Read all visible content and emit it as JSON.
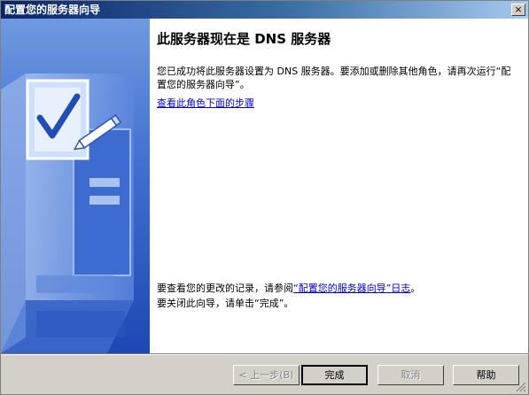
{
  "window": {
    "title": "配置您的服务器向导",
    "close_glyph": "×"
  },
  "content": {
    "heading": "此服务器现在是 DNS 服务器",
    "description": "您已成功将此服务器设置为 DNS 服务器。要添加或删除其他角色，请再次运行“配置您的服务器向导”。",
    "steps_link": "查看此角色下面的步骤",
    "log_prefix": "要查看您的更改的记录，请参阅",
    "log_link": "“配置您的服务器向导”日志",
    "log_suffix": "。",
    "finish_instruction": "要关闭此向导，请单击“完成”。"
  },
  "buttons": {
    "back": "< 上一步(B)",
    "finish": "完成",
    "cancel": "取消",
    "help": "帮助"
  },
  "icons": {
    "side_graphic": "checklist-clipboard-icon",
    "close": "close-icon"
  }
}
